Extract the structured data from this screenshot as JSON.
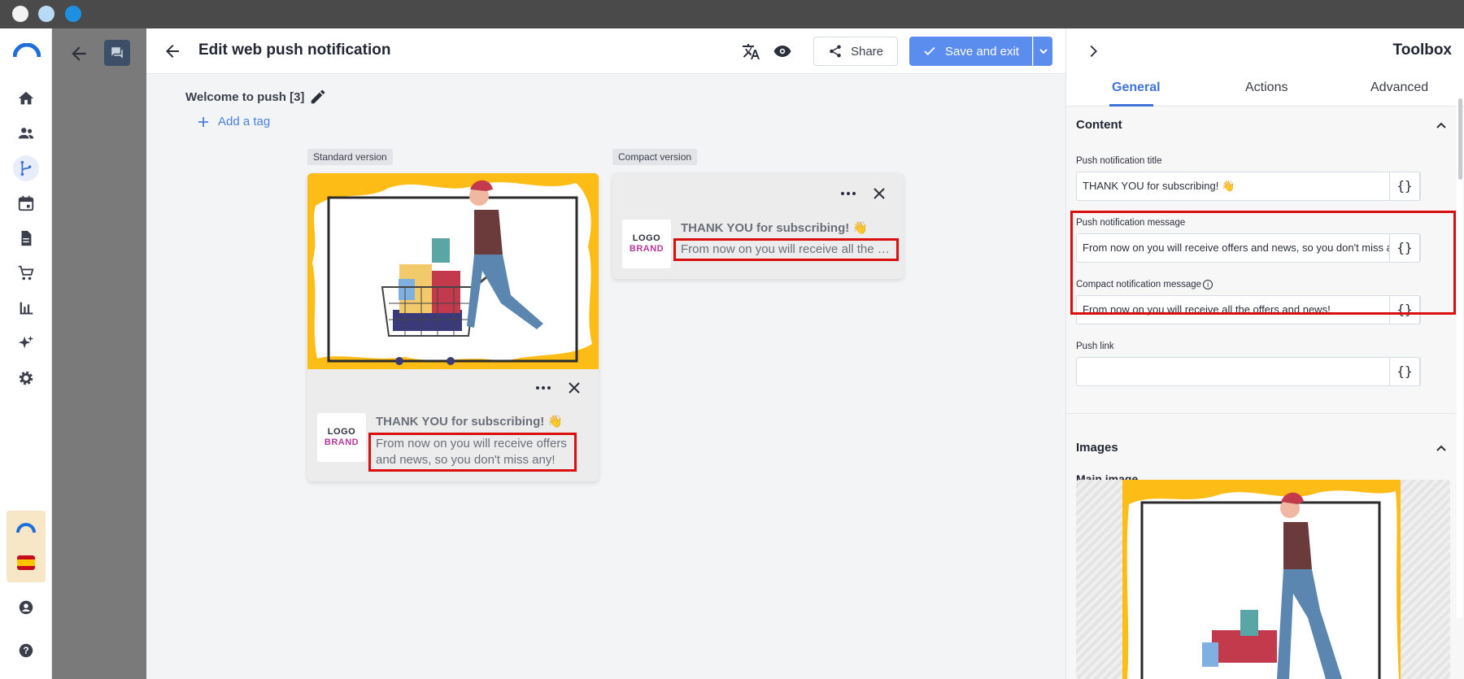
{
  "colors": {
    "accent": "#5b8def",
    "highlight": "#d90f0f",
    "hero_bg": "#fdbc16",
    "brand_purple": "#b43a9b"
  },
  "nav": {
    "icons": [
      "home-icon",
      "contacts-icon",
      "journeys-icon",
      "calendar-icon",
      "document-icon",
      "cart-icon",
      "analytics-icon",
      "ai-sparkle-icon",
      "settings-icon",
      "user-account-icon",
      "help-icon"
    ]
  },
  "editor": {
    "title": "Edit web push notification",
    "share_label": "Share",
    "save_label": "Save and exit",
    "message_name": "Welcome to push [3]",
    "add_tag_label": "Add a tag",
    "standard_label": "Standard version",
    "compact_label": "Compact version"
  },
  "preview": {
    "logo_line1": "LOGO",
    "logo_line2": "BRAND",
    "title": "THANK YOU for subscribing! 👋",
    "standard_body": "From now on you will receive offers and news, so you don't miss any!",
    "compact_body": "From now on you will receive all the …"
  },
  "toolbox": {
    "title": "Toolbox",
    "tabs": [
      {
        "label": "General",
        "active": true
      },
      {
        "label": "Actions",
        "active": false
      },
      {
        "label": "Advanced",
        "active": false
      }
    ],
    "content": {
      "header": "Content",
      "title_label": "Push notification title",
      "title_value": "THANK YOU for subscribing! 👋",
      "message_label": "Push notification message",
      "message_value": "From now on you will receive offers and news, so you don't miss any!",
      "compact_label": "Compact notification message",
      "compact_value": "From now on you will receive all the offers and news!",
      "link_label": "Push link",
      "link_value": "",
      "brace_label": "{}"
    },
    "images": {
      "header": "Images",
      "main_image_label": "Main image"
    }
  }
}
